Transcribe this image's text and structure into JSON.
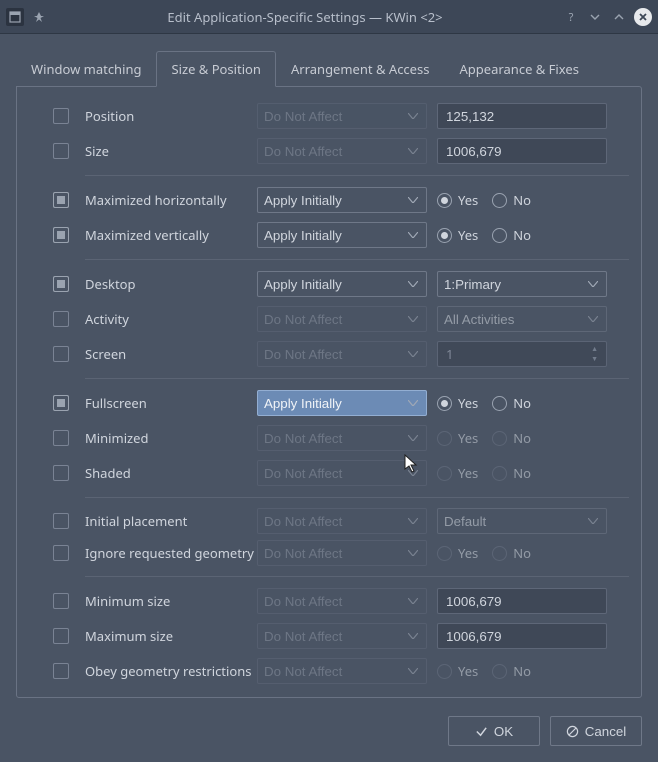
{
  "window": {
    "title": "Edit Application-Specific Settings — KWin <2>"
  },
  "tabs": [
    {
      "label": "Window matching"
    },
    {
      "label": "Size & Position"
    },
    {
      "label": "Arrangement & Access"
    },
    {
      "label": "Appearance & Fixes"
    }
  ],
  "active_tab": 1,
  "rule_options": {
    "do_not_affect": "Do Not Affect",
    "apply_initially": "Apply Initially"
  },
  "rows": {
    "position": {
      "label": "Position",
      "enabled": false,
      "rule": "Do Not Affect",
      "value": "125,132",
      "type": "text"
    },
    "size": {
      "label": "Size",
      "enabled": false,
      "rule": "Do Not Affect",
      "value": "1006,679",
      "type": "text"
    },
    "max_h": {
      "label": "Maximized horizontally",
      "enabled": true,
      "rule": "Apply Initially",
      "yes": "Yes",
      "no": "No",
      "checked": "yes",
      "type": "radio"
    },
    "max_v": {
      "label": "Maximized vertically",
      "enabled": true,
      "rule": "Apply Initially",
      "yes": "Yes",
      "no": "No",
      "checked": "yes",
      "type": "radio"
    },
    "desktop": {
      "label": "Desktop",
      "enabled": true,
      "rule": "Apply Initially",
      "value": "1:Primary",
      "type": "select"
    },
    "activity": {
      "label": "Activity",
      "enabled": false,
      "rule": "Do Not Affect",
      "value": "All Activities",
      "type": "select"
    },
    "screen": {
      "label": "Screen",
      "enabled": false,
      "rule": "Do Not Affect",
      "value": "1",
      "type": "spin"
    },
    "fullscreen": {
      "label": "Fullscreen",
      "enabled": true,
      "rule": "Apply Initially",
      "yes": "Yes",
      "no": "No",
      "checked": "yes",
      "type": "radio",
      "highlight": true
    },
    "minimized": {
      "label": "Minimized",
      "enabled": false,
      "rule": "Do Not Affect",
      "yes": "Yes",
      "no": "No",
      "type": "radio"
    },
    "shaded": {
      "label": "Shaded",
      "enabled": false,
      "rule": "Do Not Affect",
      "yes": "Yes",
      "no": "No",
      "type": "radio"
    },
    "placement": {
      "label": "Initial placement",
      "enabled": false,
      "rule": "Do Not Affect",
      "value": "Default",
      "type": "select"
    },
    "ignore_geo": {
      "label": "Ignore requested geometry",
      "enabled": false,
      "rule": "Do Not Affect",
      "yes": "Yes",
      "no": "No",
      "type": "radio"
    },
    "min_size": {
      "label": "Minimum size",
      "enabled": false,
      "rule": "Do Not Affect",
      "value": "1006,679",
      "type": "text"
    },
    "max_size": {
      "label": "Maximum size",
      "enabled": false,
      "rule": "Do Not Affect",
      "value": "1006,679",
      "type": "text"
    },
    "obey": {
      "label": "Obey geometry restrictions",
      "enabled": false,
      "rule": "Do Not Affect",
      "yes": "Yes",
      "no": "No",
      "type": "radio"
    }
  },
  "footer": {
    "ok": "OK",
    "cancel": "Cancel"
  }
}
